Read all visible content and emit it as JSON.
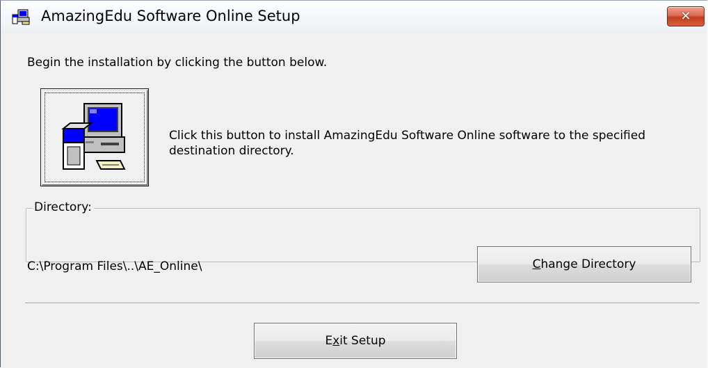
{
  "window": {
    "title": "AmazingEdu Software Online Setup",
    "close_glyph": "✕",
    "title_icon": "setup-computer-icon"
  },
  "instruction": "Begin the installation by clicking the button below.",
  "install": {
    "icon": "setup-computer-icon",
    "description": "Click this button to install AmazingEdu Software Online software to the specified destination directory."
  },
  "directory": {
    "group_label": "Directory:",
    "path": "C:\\Program Files\\..\\AE_Online\\",
    "change_button": {
      "mnemonic": "C",
      "rest": "hange Directory"
    }
  },
  "exit_button": {
    "before": "E",
    "mnemonic": "x",
    "after": "it Setup"
  },
  "colors": {
    "dialog_bg": "#f0f0f0",
    "close_button_red": "#c33d1f",
    "monitor_screen": "#0000ff"
  }
}
